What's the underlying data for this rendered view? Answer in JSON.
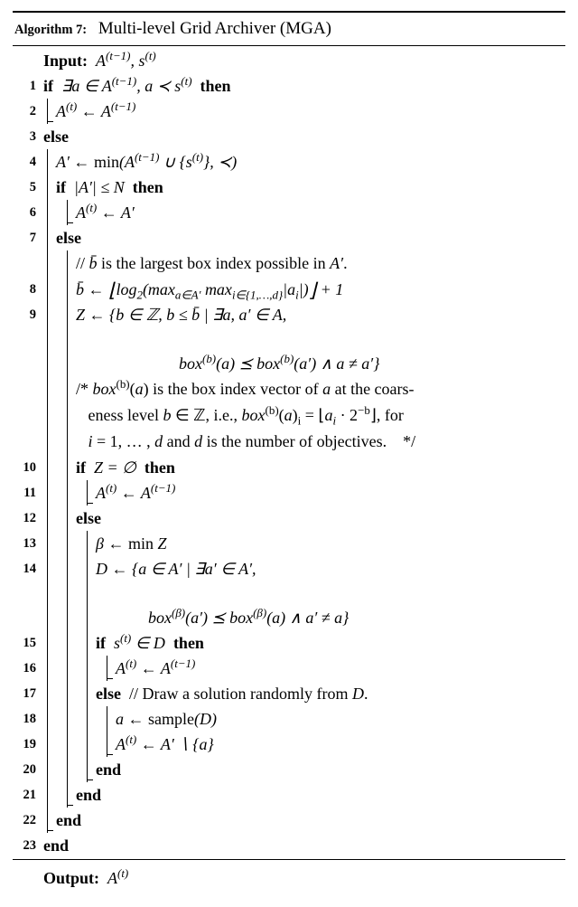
{
  "header": {
    "label": "Algorithm 7:",
    "title": "Multi-level Grid Archiver (MGA)"
  },
  "io": {
    "input_kw": "Input:",
    "input_expr": "A⁽ᵗ⁻¹⁾, s⁽ᵗ⁾",
    "output_kw": "Output:",
    "output_expr": "A⁽ᵗ⁾"
  },
  "kw": {
    "if": "if",
    "then": "then",
    "else": "else",
    "end": "end"
  },
  "lines": {
    "l1": "∃a ∈ A⁽ᵗ⁻¹⁾, a ≺ s⁽ᵗ⁾",
    "l2": "A⁽ᵗ⁾ ← A⁽ᵗ⁻¹⁾",
    "l4": "A′ ← min(A⁽ᵗ⁻¹⁾ ∪ {s⁽ᵗ⁾}, ≺)",
    "l5": "|A′| ≤ N",
    "l6": "A⁽ᵗ⁾ ← A′",
    "c_bbar": "// b̄ is the largest box index possible in A′.",
    "l8": "b̄ ← ⌊log₂(maxₐ∈A′ maxᵢ∈{1,…,d}|aᵢ|)⌋ + 1",
    "l9a": "𝒵 ← {b ∈ ℤ, b ≤ b̄ | ∃a, a′ ∈ A,",
    "l9b": "box⁽ᵇ⁾(a) ⪯ box⁽ᵇ⁾(a′) ∧ a ≠ a′}",
    "c_box1": "/* box⁽ᵇ⁾(a) is the box index vector of a at the coars-",
    "c_box2": "eness level b ∈ ℤ, i.e., box⁽ᵇ⁾(a)ᵢ = ⌊aᵢ · 2⁻ᵇ⌋, for",
    "c_box3": "i = 1, … , d and d is the number of objectives.    */",
    "l10": "𝒵 = ∅",
    "l11": "A⁽ᵗ⁾ ← A⁽ᵗ⁻¹⁾",
    "l13": "β ← min 𝒵",
    "l14a": "D ← {a ∈ A′ | ∃a′ ∈ A′,",
    "l14b": "box⁽ᵝ⁾(a′) ⪯ box⁽ᵝ⁾(a) ∧ a′ ≠ a}",
    "l15": "s⁽ᵗ⁾ ∈ D",
    "l16": "A⁽ᵗ⁾ ← A⁽ᵗ⁻¹⁾",
    "c_draw": "// Draw a solution randomly from D.",
    "l18": "a ← sample(D)",
    "l19": "A⁽ᵗ⁾ ← A′ ∖ {a}"
  }
}
